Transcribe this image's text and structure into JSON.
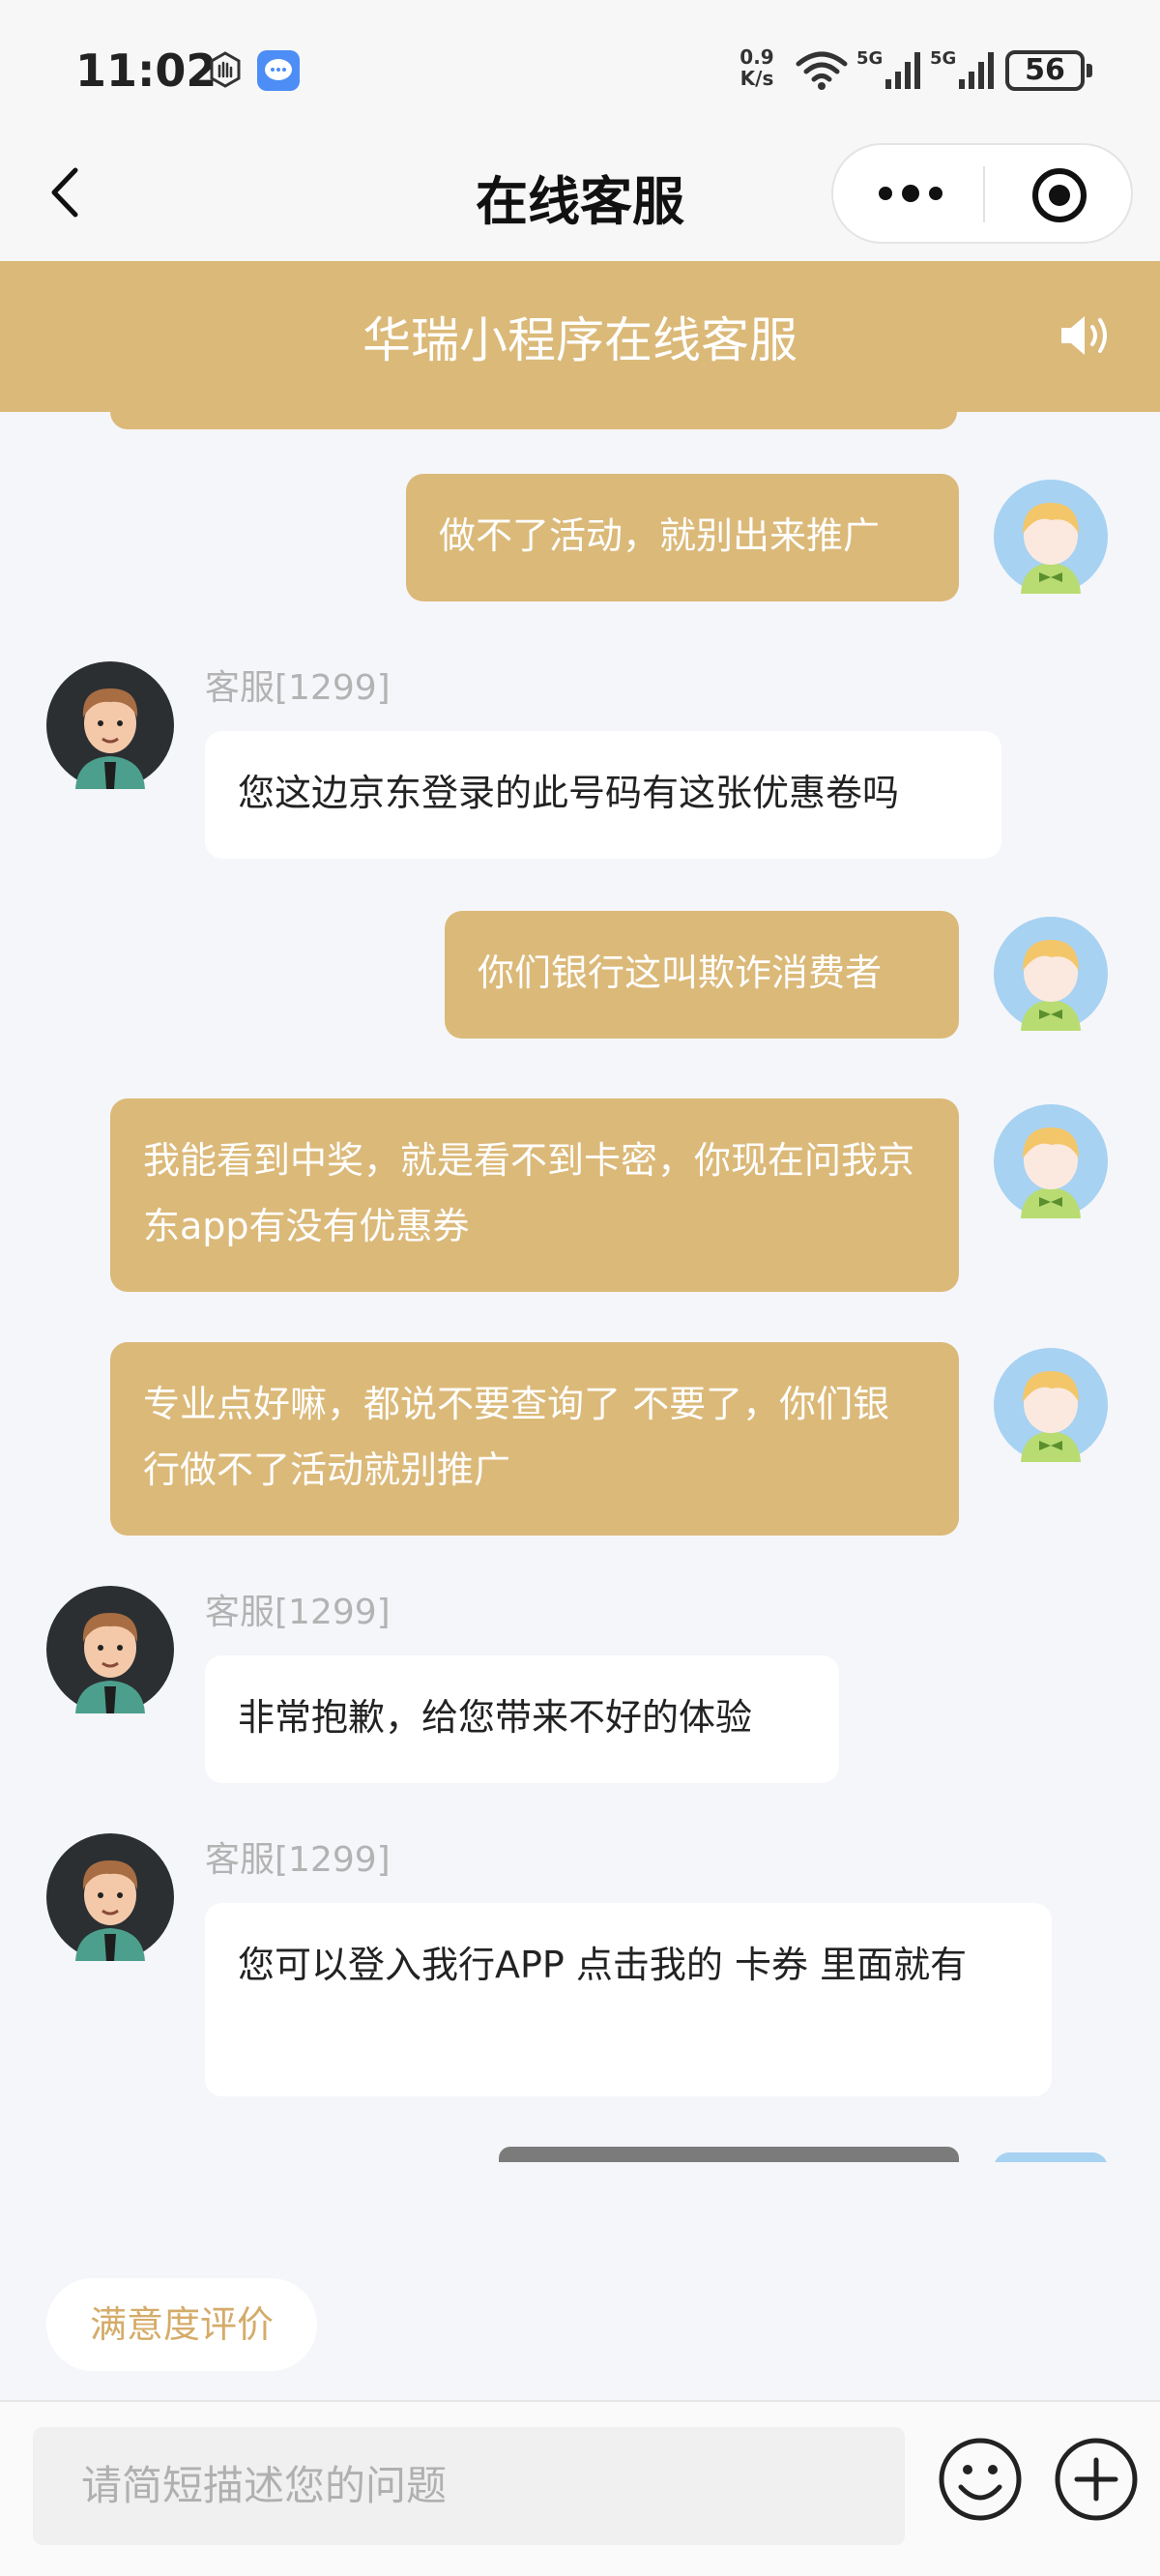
{
  "status_bar": {
    "time": "11:02",
    "net_speed": "0.9\nK/s",
    "battery": "56"
  },
  "nav": {
    "title": "在线客服"
  },
  "banner": {
    "title": "华瑞小程序在线客服"
  },
  "messages": [
    {
      "from": "user",
      "text": "做不了活动，就别出来推广"
    },
    {
      "from": "agent",
      "name": "客服[1299]",
      "text": "您这边京东登录的此号码有这张优惠卷吗"
    },
    {
      "from": "user",
      "text": "你们银行这叫欺诈消费者"
    },
    {
      "from": "user",
      "text": "我能看到中奖，就是看不到卡密，你现在问我京东app有没有优惠券"
    },
    {
      "from": "user",
      "text": "专业点好嘛，都说不要查询了 不要了，你们银行做不了活动就别推广"
    },
    {
      "from": "agent",
      "name": "客服[1299]",
      "text": "非常抱歉，给您带来不好的体验"
    },
    {
      "from": "agent",
      "name": "客服[1299]",
      "text": "您可以登入我行APP 点击我的 卡券 里面就有"
    }
  ],
  "rate": {
    "label": "满意度评价"
  },
  "input": {
    "placeholder": "请简短描述您的问题"
  },
  "icons": {
    "back": "chevron-left-icon",
    "more": "more-dots-icon",
    "target": "target-icon",
    "speaker": "speaker-icon",
    "emoji": "emoji-icon",
    "plus": "plus-icon"
  },
  "colors": {
    "accent": "#dbb979",
    "rate_text": "#d4ac6a",
    "user_avatar_bg": "#a7d2f2",
    "agent_avatar_bg": "#2b2f32"
  }
}
